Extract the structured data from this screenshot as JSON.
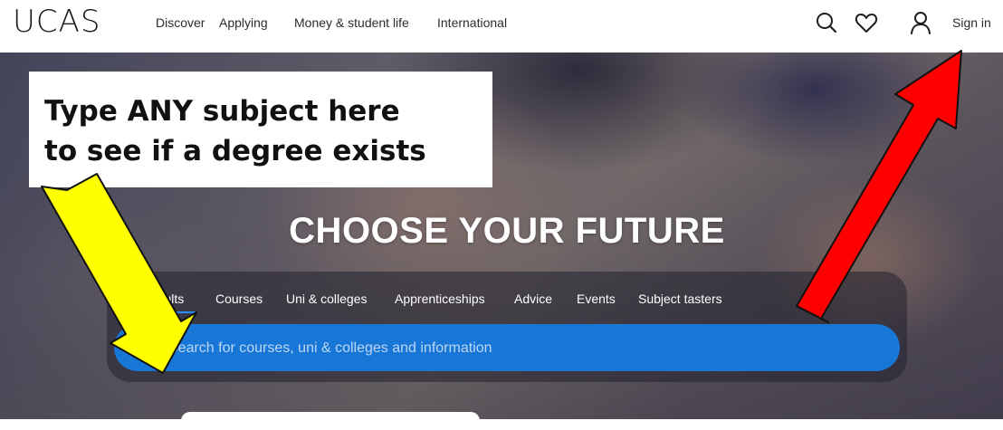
{
  "header": {
    "logo": "UCAS",
    "nav": [
      "Discover",
      "Applying",
      "Money & student life",
      "International"
    ],
    "icons": [
      "search-icon",
      "heart-icon",
      "user-icon"
    ],
    "sign_in": "Sign in"
  },
  "hero": {
    "title": "CHOOSE YOUR FUTURE",
    "tabs": [
      "results",
      "Courses",
      "Uni & colleges",
      "Apprenticeships",
      "Advice",
      "Events",
      "Subject tasters"
    ],
    "active_tab": "results",
    "search": {
      "placeholder": "Search for courses, uni & colleges and information",
      "value": ""
    }
  },
  "annotation": {
    "line1": "Type ANY subject here",
    "line2": "to see if a degree exists",
    "arrows": [
      {
        "color": "#ffff00",
        "points_to": "search-input"
      },
      {
        "color": "#ff0000",
        "points_to": "sign-in-link"
      }
    ]
  },
  "colors": {
    "search_bar": "#1877d6",
    "active_tab_underline": "#2b8cff",
    "arrow_yellow": "#ffff00",
    "arrow_red": "#ff0000"
  }
}
